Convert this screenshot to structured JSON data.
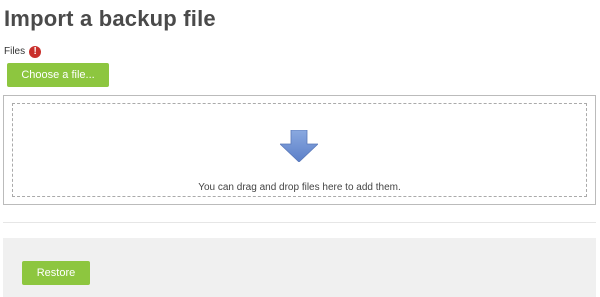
{
  "page": {
    "title": "Import a backup file"
  },
  "form": {
    "files_label": "Files",
    "required_icon": "!",
    "choose_button_label": "Choose a file...",
    "drop_hint": "You can drag and drop files here to add them."
  },
  "footer": {
    "restore_label": "Restore"
  },
  "colors": {
    "button_green": "#8dc63f",
    "required_red": "#c9302c",
    "arrow_blue": "#6e8fd0",
    "footer_bg": "#f0f0f0"
  },
  "icons": {
    "required": "exclamation-circle-icon",
    "drop_arrow": "arrow-down-icon"
  }
}
